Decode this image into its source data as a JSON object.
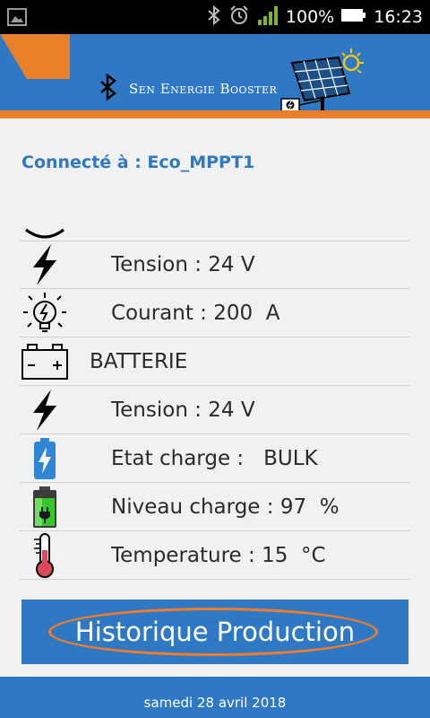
{
  "status_bar": {
    "battery_percent": "100%",
    "time": "16:23",
    "icons": [
      "image-icon",
      "bluetooth-icon",
      "alarm-icon",
      "signal-icon",
      "battery-icon"
    ]
  },
  "header": {
    "brand": "Sen Energie Booster",
    "icons": [
      "bluetooth-icon",
      "solar-panel-icon"
    ],
    "colors": {
      "primary": "#2f79c4",
      "accent": "#e8802a"
    }
  },
  "connection": {
    "label": "Connecté à : Eco_MPPT1"
  },
  "rows": [
    {
      "icon": "lightning-icon",
      "label": "Tension : 24 V"
    },
    {
      "icon": "lightbulb-icon",
      "label": "Courant : 200  A"
    },
    {
      "icon": "battery-outline-icon",
      "label": "BATTERIE"
    },
    {
      "icon": "lightning-icon",
      "label": "Tension : 24 V"
    },
    {
      "icon": "battery-charging-icon",
      "label": "Etat charge :   BULK"
    },
    {
      "icon": "battery-level-icon",
      "label": "Niveau charge : 97  %"
    },
    {
      "icon": "thermometer-icon",
      "label": "Temperature : 15  °C"
    }
  ],
  "button": {
    "label": "Historique Production"
  },
  "footer": {
    "date": "samedi 28 avril 2018"
  }
}
